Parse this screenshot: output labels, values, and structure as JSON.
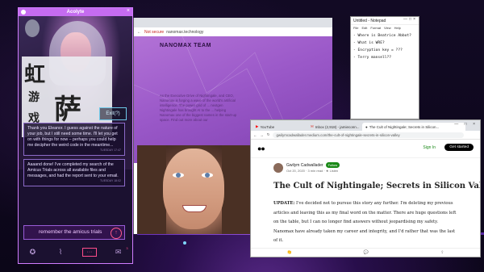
{
  "acolyte": {
    "window_title": "Acolyte",
    "close_glyph": "×",
    "brand_glyph_top": "虹",
    "brand_glyph_mid": "游",
    "brand_glyph_low": "戏",
    "brand_glyph_big": "萨",
    "exit_button": "Exit(?)",
    "messages": [
      {
        "text": "Thank you Eleanor. I guess against the nature of your job, but I still need some time. I'll let you get on with things for now – perhaps you could help me decipher the weird code in the meantime...",
        "ts": "TUESDAY 17:47"
      },
      {
        "text": "Aaaand done! I've completed my search of the Amicus Trials across all available files and messages, and had the report sent to your email.",
        "ts": "TUESDAY 18:02"
      }
    ],
    "input_text": "remember the amicus trials",
    "send_icon": "↑",
    "nav": [
      {
        "icon": "✪",
        "name": "nav-profile-icon"
      },
      {
        "icon": "⌇",
        "name": "nav-hanger-icon"
      },
      {
        "icon": "···",
        "name": "nav-chat-icon"
      },
      {
        "icon": "✉",
        "name": "nav-mail-icon",
        "badge": "3"
      }
    ]
  },
  "nanomax_browser": {
    "security_label": "Not secure",
    "url": "nanomax.technology",
    "heading": "NANOMAX TEAM",
    "paragraph": "As the Executive Drive of Nightingale, and CEO, Nanomax is forging a wave of the world's artificial intelligence. The power grid of ... nextgen Nightingale has brought AI to the ... helping Nanomax one of the biggest names in the start-up space. Find out more about our"
  },
  "notepad": {
    "title": "Untitled - Notepad",
    "window_controls": "—□×",
    "menu": [
      "File",
      "Edit",
      "Format",
      "View",
      "Help"
    ],
    "lines": [
      "- Where is Beatrice Abbot?",
      "- What is WRE?",
      "- Encryption key = ???",
      "- Terry mansell??"
    ]
  },
  "medium_browser": {
    "tabs": [
      {
        "label": "YouTube",
        "icon_color": "#ff0000"
      },
      {
        "label": "Inbox (2,918) - jamieconn...",
        "icon_color": "#d93025"
      },
      {
        "label": "The Cult of Nightingale; Secrets in Silicon...",
        "icon_color": "#333333"
      }
    ],
    "window_controls": "— □ ×",
    "url": "gwilymcadwallader.medium.com/the-cult-of-nightingale-secrets-in-silicon-valley",
    "logo": "●●",
    "signin": "Sign In",
    "get_started": "Get started",
    "author": "Gwilym Cadwallader",
    "follow": "Follow",
    "meta": "Oct 20, 2020 · 3 min read · ★ Listen",
    "title": "The Cult of Nightingale; Secrets in Silicon Valley",
    "update_label": "UPDATE:",
    "body": " I've decided not to pursue this story any further. I'm deleting my previous articles and leaving this as my final word on the matter. There are huge questions left on the table, but I can no longer find answers without jeopardising my safety. Nanomax have already taken my career and integrity, and I'd rather that was the last of it.",
    "footer_icons": [
      "👏",
      "💬",
      "⇪"
    ]
  }
}
